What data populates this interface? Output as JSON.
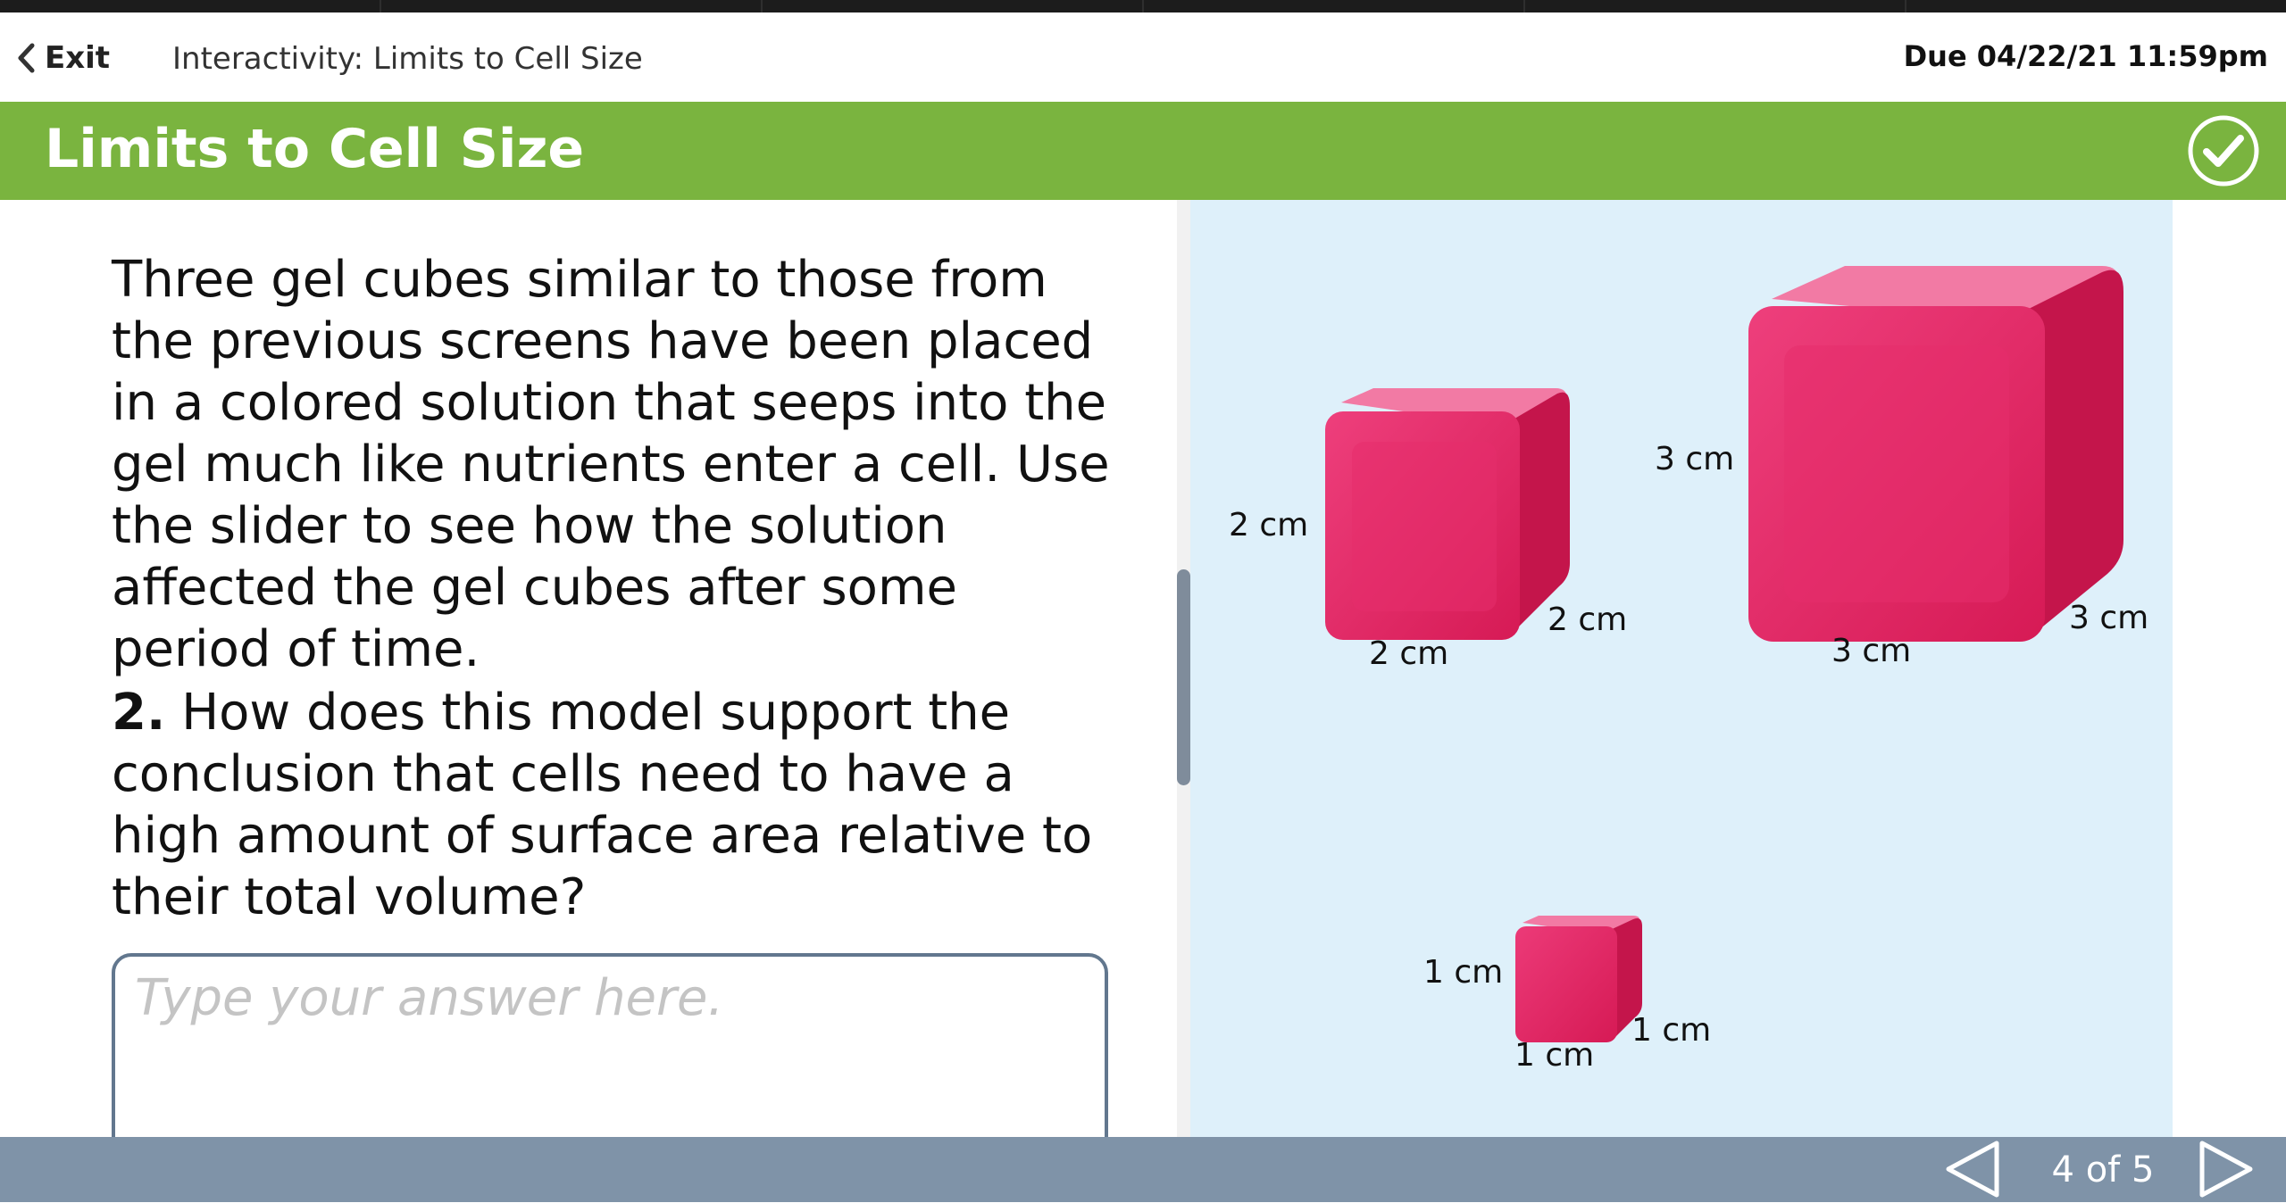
{
  "header": {
    "exit_label": "Exit",
    "activity_title": "Interactivity: Limits to Cell Size",
    "due_date": "Due 04/22/21 11:59pm"
  },
  "title_bar": {
    "title": "Limits to Cell Size",
    "icon": "check-circle-icon"
  },
  "content": {
    "intro": "Three gel cubes similar to those from the previous screens have been placed in a colored solution that seeps into the gel much like nutrients enter a cell. Use the slider to see how the solution affected the gel cubes after some period of time.",
    "question_number": "2.",
    "question_text": "How does this model support the conclusion that cells need to have a high amount of surface area relative to their total volume?",
    "answer_placeholder": "Type your answer here.",
    "answer_value": ""
  },
  "figure": {
    "cubes": [
      {
        "name": "medium",
        "height_label": "2 cm",
        "width_label": "2 cm",
        "depth_label": "2 cm"
      },
      {
        "name": "large",
        "height_label": "3 cm",
        "width_label": "3 cm",
        "depth_label": "3 cm"
      },
      {
        "name": "small",
        "height_label": "1 cm",
        "width_label": "1 cm",
        "depth_label": "1 cm"
      }
    ],
    "cube_color": "#e0245e"
  },
  "footer": {
    "page_indicator": "4 of 5",
    "prev_icon": "triangle-left-icon",
    "next_icon": "triangle-right-icon"
  },
  "colors": {
    "accent_green": "#7ab43f",
    "footer_bg": "#7f93a8",
    "figure_bg": "#def0fa"
  }
}
